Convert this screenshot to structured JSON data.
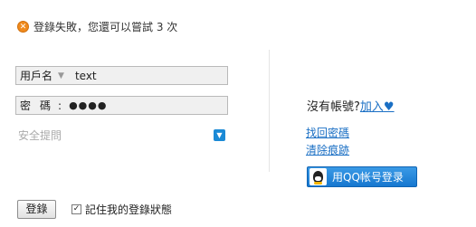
{
  "error": {
    "icon": "close-circle-icon",
    "message": "登錄失敗，您還可以嘗試 3 次"
  },
  "username": {
    "label": "用戶名",
    "dropdown_icon": "triangle-down-icon",
    "value": "text"
  },
  "password": {
    "label": "密碼",
    "colon": ":",
    "value": "●●●●"
  },
  "security": {
    "placeholder": "安全提問",
    "dropdown_icon": "chevron-down-icon"
  },
  "side": {
    "register_prompt": "沒有帳號?",
    "register_link": "加入",
    "heart": "♥",
    "forgot_password": "找回密碼",
    "clear_traces": "清除痕跡",
    "qq_login": "用QQ帐号登录"
  },
  "footer": {
    "login_button": "登錄",
    "remember_checked": true,
    "remember_label": "記住我的登錄狀態"
  },
  "colors": {
    "link": "#1a6fc4",
    "error_icon": "#f08a1c",
    "qq_button": "#1677cf"
  }
}
